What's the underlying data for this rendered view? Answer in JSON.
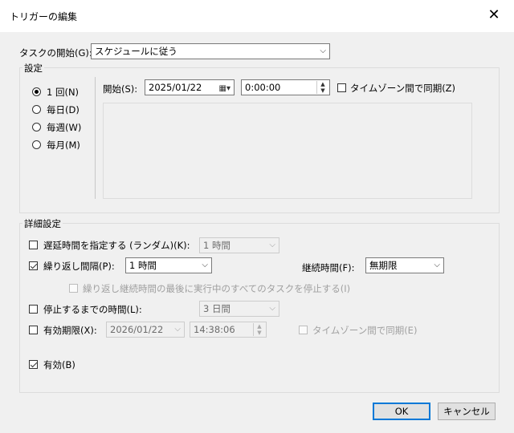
{
  "window": {
    "title": "トリガーの編集",
    "close_glyph": "✕"
  },
  "task_start": {
    "label": "タスクの開始(G):",
    "value": "スケジュールに従う"
  },
  "settings": {
    "legend": "設定",
    "radios": [
      {
        "label": "1 回(N)",
        "selected": true
      },
      {
        "label": "毎日(D)",
        "selected": false
      },
      {
        "label": "毎週(W)",
        "selected": false
      },
      {
        "label": "毎月(M)",
        "selected": false
      }
    ],
    "start_label": "開始(S):",
    "start_date": "2025/01/22",
    "start_time": "0:00:00",
    "sync_timezone": {
      "label": "タイムゾーン間で同期(Z)",
      "checked": false
    }
  },
  "advanced": {
    "legend": "詳細設定",
    "delay": {
      "label": "遅延時間を指定する (ランダム)(K):",
      "checked": false,
      "value": "1 時間"
    },
    "repeat": {
      "label": "繰り返し間隔(P):",
      "checked": true,
      "value": "1 時間"
    },
    "duration": {
      "label": "継続時間(F):",
      "value": "無期限"
    },
    "stop_at_end": {
      "label": "繰り返し継続時間の最後に実行中のすべてのタスクを停止する(I)",
      "checked": false
    },
    "stop_after": {
      "label": "停止するまでの時間(L):",
      "checked": false,
      "value": "3 日間"
    },
    "expire": {
      "label": "有効期限(X):",
      "checked": false,
      "date": "2026/01/22",
      "time": "14:38:06"
    },
    "expire_sync": {
      "label": "タイムゾーン間で同期(E)",
      "checked": false
    },
    "enabled": {
      "label": "有効(B)",
      "checked": true
    }
  },
  "buttons": {
    "ok": "OK",
    "cancel": "キャンセル"
  }
}
